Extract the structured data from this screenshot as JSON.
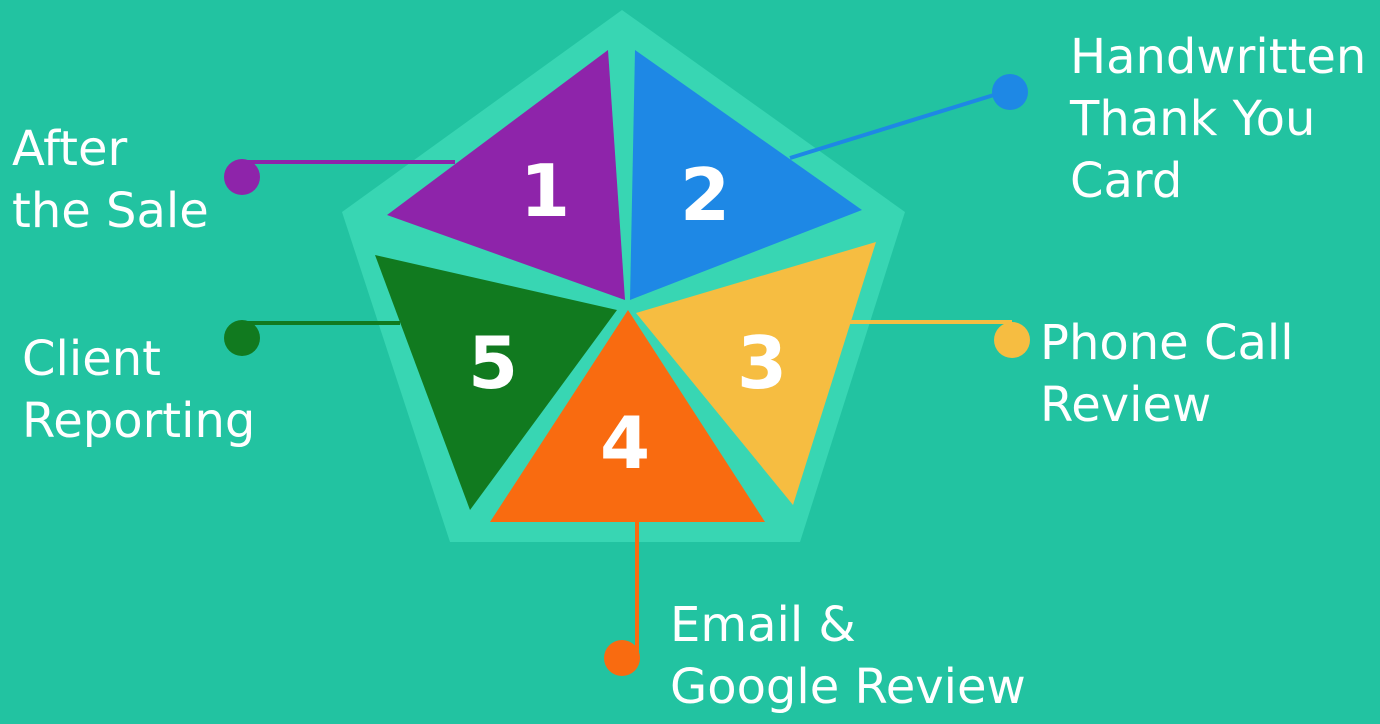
{
  "colors": {
    "background": "#22c3a1",
    "pentagon_frame": "#38d6b3",
    "step1": "#8e24aa",
    "step2": "#1e88e5",
    "step3": "#f6bd41",
    "step4": "#f96b10",
    "step5": "#117a1f"
  },
  "steps": [
    {
      "number": "1",
      "lines": [
        "After",
        "the Sale"
      ]
    },
    {
      "number": "2",
      "lines": [
        "Handwritten",
        "Thank You",
        "Card"
      ]
    },
    {
      "number": "3",
      "lines": [
        "Phone Call",
        "Review"
      ]
    },
    {
      "number": "4",
      "lines": [
        "Email &",
        "Google Review"
      ]
    },
    {
      "number": "5",
      "lines": [
        "Client",
        "Reporting"
      ]
    }
  ]
}
